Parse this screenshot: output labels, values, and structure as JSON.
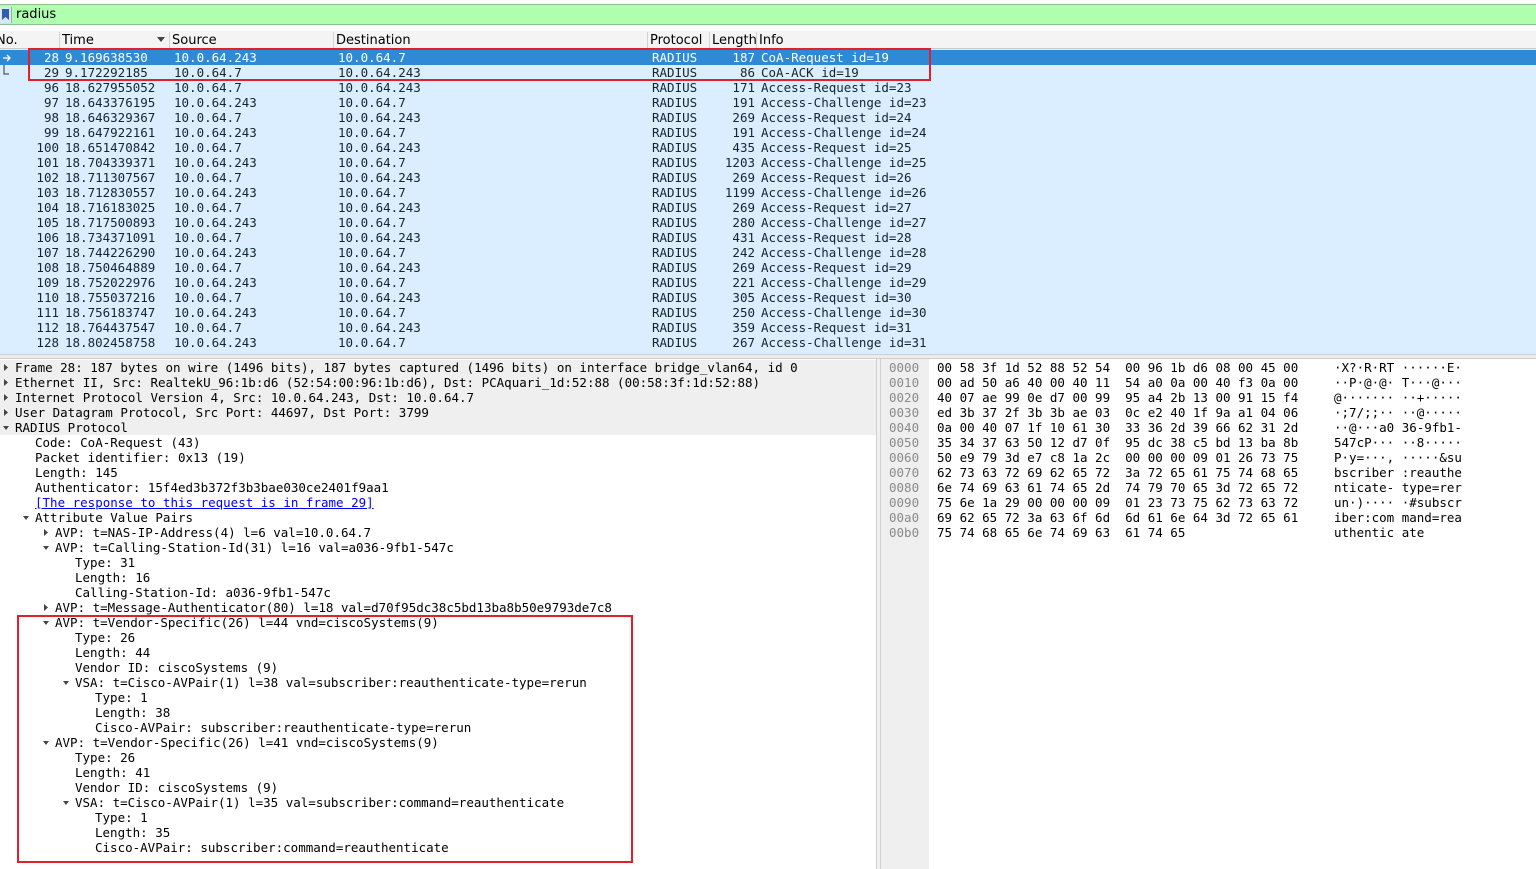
{
  "filter": {
    "value": "radius"
  },
  "columns": [
    "No.",
    "Time",
    "Source",
    "Destination",
    "Protocol",
    "Length",
    "Info"
  ],
  "packets": [
    {
      "no": "28",
      "time": "9.169638530",
      "src": "10.0.64.243",
      "dst": "10.0.64.7",
      "proto": "RADIUS",
      "len": "187",
      "info": "CoA-Request id=19"
    },
    {
      "no": "29",
      "time": "9.172292185",
      "src": "10.0.64.7",
      "dst": "10.0.64.243",
      "proto": "RADIUS",
      "len": "86",
      "info": "CoA-ACK id=19"
    },
    {
      "no": "96",
      "time": "18.627955052",
      "src": "10.0.64.7",
      "dst": "10.0.64.243",
      "proto": "RADIUS",
      "len": "171",
      "info": "Access-Request id=23"
    },
    {
      "no": "97",
      "time": "18.643376195",
      "src": "10.0.64.243",
      "dst": "10.0.64.7",
      "proto": "RADIUS",
      "len": "191",
      "info": "Access-Challenge id=23"
    },
    {
      "no": "98",
      "time": "18.646329367",
      "src": "10.0.64.7",
      "dst": "10.0.64.243",
      "proto": "RADIUS",
      "len": "269",
      "info": "Access-Request id=24"
    },
    {
      "no": "99",
      "time": "18.647922161",
      "src": "10.0.64.243",
      "dst": "10.0.64.7",
      "proto": "RADIUS",
      "len": "191",
      "info": "Access-Challenge id=24"
    },
    {
      "no": "100",
      "time": "18.651470842",
      "src": "10.0.64.7",
      "dst": "10.0.64.243",
      "proto": "RADIUS",
      "len": "435",
      "info": "Access-Request id=25"
    },
    {
      "no": "101",
      "time": "18.704339371",
      "src": "10.0.64.243",
      "dst": "10.0.64.7",
      "proto": "RADIUS",
      "len": "1203",
      "info": "Access-Challenge id=25"
    },
    {
      "no": "102",
      "time": "18.711307567",
      "src": "10.0.64.7",
      "dst": "10.0.64.243",
      "proto": "RADIUS",
      "len": "269",
      "info": "Access-Request id=26"
    },
    {
      "no": "103",
      "time": "18.712830557",
      "src": "10.0.64.243",
      "dst": "10.0.64.7",
      "proto": "RADIUS",
      "len": "1199",
      "info": "Access-Challenge id=26"
    },
    {
      "no": "104",
      "time": "18.716183025",
      "src": "10.0.64.7",
      "dst": "10.0.64.243",
      "proto": "RADIUS",
      "len": "269",
      "info": "Access-Request id=27"
    },
    {
      "no": "105",
      "time": "18.717500893",
      "src": "10.0.64.243",
      "dst": "10.0.64.7",
      "proto": "RADIUS",
      "len": "280",
      "info": "Access-Challenge id=27"
    },
    {
      "no": "106",
      "time": "18.734371091",
      "src": "10.0.64.7",
      "dst": "10.0.64.243",
      "proto": "RADIUS",
      "len": "431",
      "info": "Access-Request id=28"
    },
    {
      "no": "107",
      "time": "18.744226290",
      "src": "10.0.64.243",
      "dst": "10.0.64.7",
      "proto": "RADIUS",
      "len": "242",
      "info": "Access-Challenge id=28"
    },
    {
      "no": "108",
      "time": "18.750464889",
      "src": "10.0.64.7",
      "dst": "10.0.64.243",
      "proto": "RADIUS",
      "len": "269",
      "info": "Access-Request id=29"
    },
    {
      "no": "109",
      "time": "18.752022976",
      "src": "10.0.64.243",
      "dst": "10.0.64.7",
      "proto": "RADIUS",
      "len": "221",
      "info": "Access-Challenge id=29"
    },
    {
      "no": "110",
      "time": "18.755037216",
      "src": "10.0.64.7",
      "dst": "10.0.64.243",
      "proto": "RADIUS",
      "len": "305",
      "info": "Access-Request id=30"
    },
    {
      "no": "111",
      "time": "18.756183747",
      "src": "10.0.64.243",
      "dst": "10.0.64.7",
      "proto": "RADIUS",
      "len": "250",
      "info": "Access-Challenge id=30"
    },
    {
      "no": "112",
      "time": "18.764437547",
      "src": "10.0.64.7",
      "dst": "10.0.64.243",
      "proto": "RADIUS",
      "len": "359",
      "info": "Access-Request id=31"
    },
    {
      "no": "128",
      "time": "18.802458758",
      "src": "10.0.64.243",
      "dst": "10.0.64.7",
      "proto": "RADIUS",
      "len": "267",
      "info": "Access-Challenge id=31"
    }
  ],
  "selected_packet_index": 0,
  "details": [
    {
      "level": 0,
      "toggle": "collapsed",
      "text": "Frame 28: 187 bytes on wire (1496 bits), 187 bytes captured (1496 bits) on interface bridge_vlan64, id 0"
    },
    {
      "level": 0,
      "toggle": "collapsed",
      "text": "Ethernet II, Src: RealtekU_96:1b:d6 (52:54:00:96:1b:d6), Dst: PCAquari_1d:52:88 (00:58:3f:1d:52:88)"
    },
    {
      "level": 0,
      "toggle": "collapsed",
      "text": "Internet Protocol Version 4, Src: 10.0.64.243, Dst: 10.0.64.7"
    },
    {
      "level": 0,
      "toggle": "collapsed",
      "text": "User Datagram Protocol, Src Port: 44697, Dst Port: 3799"
    },
    {
      "level": 0,
      "toggle": "expanded",
      "text": "RADIUS Protocol"
    },
    {
      "level": 1,
      "toggle": "none",
      "text": "Code: CoA-Request (43)"
    },
    {
      "level": 1,
      "toggle": "none",
      "text": "Packet identifier: 0x13 (19)"
    },
    {
      "level": 1,
      "toggle": "none",
      "text": "Length: 145"
    },
    {
      "level": 1,
      "toggle": "none",
      "text": "Authenticator: 15f4ed3b372f3b3bae030ce2401f9aa1"
    },
    {
      "level": 1,
      "toggle": "none",
      "text": "[The response to this request is in frame 29]",
      "link": true
    },
    {
      "level": 1,
      "toggle": "expanded",
      "text": "Attribute Value Pairs"
    },
    {
      "level": 2,
      "toggle": "collapsed",
      "text": "AVP: t=NAS-IP-Address(4) l=6 val=10.0.64.7"
    },
    {
      "level": 2,
      "toggle": "expanded",
      "text": "AVP: t=Calling-Station-Id(31) l=16 val=a036-9fb1-547c"
    },
    {
      "level": 3,
      "toggle": "none",
      "text": "Type: 31"
    },
    {
      "level": 3,
      "toggle": "none",
      "text": "Length: 16"
    },
    {
      "level": 3,
      "toggle": "none",
      "text": "Calling-Station-Id: a036-9fb1-547c"
    },
    {
      "level": 2,
      "toggle": "collapsed",
      "text": "AVP: t=Message-Authenticator(80) l=18 val=d70f95dc38c5bd13ba8b50e9793de7c8"
    },
    {
      "level": 2,
      "toggle": "expanded",
      "text": "AVP: t=Vendor-Specific(26) l=44 vnd=ciscoSystems(9)"
    },
    {
      "level": 3,
      "toggle": "none",
      "text": "Type: 26"
    },
    {
      "level": 3,
      "toggle": "none",
      "text": "Length: 44"
    },
    {
      "level": 3,
      "toggle": "none",
      "text": "Vendor ID: ciscoSystems (9)"
    },
    {
      "level": 3,
      "toggle": "expanded",
      "text": "VSA: t=Cisco-AVPair(1) l=38 val=subscriber:reauthenticate-type=rerun"
    },
    {
      "level": 4,
      "toggle": "none",
      "text": "Type: 1"
    },
    {
      "level": 4,
      "toggle": "none",
      "text": "Length: 38"
    },
    {
      "level": 4,
      "toggle": "none",
      "text": "Cisco-AVPair: subscriber:reauthenticate-type=rerun"
    },
    {
      "level": 2,
      "toggle": "expanded",
      "text": "AVP: t=Vendor-Specific(26) l=41 vnd=ciscoSystems(9)"
    },
    {
      "level": 3,
      "toggle": "none",
      "text": "Type: 26"
    },
    {
      "level": 3,
      "toggle": "none",
      "text": "Length: 41"
    },
    {
      "level": 3,
      "toggle": "none",
      "text": "Vendor ID: ciscoSystems (9)"
    },
    {
      "level": 3,
      "toggle": "expanded",
      "text": "VSA: t=Cisco-AVPair(1) l=35 val=subscriber:command=reauthenticate"
    },
    {
      "level": 4,
      "toggle": "none",
      "text": "Type: 1"
    },
    {
      "level": 4,
      "toggle": "none",
      "text": "Length: 35"
    },
    {
      "level": 4,
      "toggle": "none",
      "text": "Cisco-AVPair: subscriber:command=reauthenticate"
    }
  ],
  "bytes": [
    {
      "offset": "0000",
      "hex": "00 58 3f 1d 52 88 52 54  00 96 1b d6 08 00 45 00",
      "ascii": "·X?·R·RT ······E·"
    },
    {
      "offset": "0010",
      "hex": "00 ad 50 a6 40 00 40 11  54 a0 0a 00 40 f3 0a 00",
      "ascii": "··P·@·@· T···@···"
    },
    {
      "offset": "0020",
      "hex": "40 07 ae 99 0e d7 00 99  95 a4 2b 13 00 91 15 f4",
      "ascii": "@······· ··+·····"
    },
    {
      "offset": "0030",
      "hex": "ed 3b 37 2f 3b 3b ae 03  0c e2 40 1f 9a a1 04 06",
      "ascii": "·;7/;;·· ··@·····"
    },
    {
      "offset": "0040",
      "hex": "0a 00 40 07 1f 10 61 30  33 36 2d 39 66 62 31 2d",
      "ascii": "··@···a0 36-9fb1-"
    },
    {
      "offset": "0050",
      "hex": "35 34 37 63 50 12 d7 0f  95 dc 38 c5 bd 13 ba 8b",
      "ascii": "547cP··· ··8·····"
    },
    {
      "offset": "0060",
      "hex": "50 e9 79 3d e7 c8 1a 2c  00 00 00 09 01 26 73 75",
      "ascii": "P·y=···, ·····&su"
    },
    {
      "offset": "0070",
      "hex": "62 73 63 72 69 62 65 72  3a 72 65 61 75 74 68 65",
      "ascii": "bscriber :reauthe"
    },
    {
      "offset": "0080",
      "hex": "6e 74 69 63 61 74 65 2d  74 79 70 65 3d 72 65 72",
      "ascii": "nticate- type=rer"
    },
    {
      "offset": "0090",
      "hex": "75 6e 1a 29 00 00 00 09  01 23 73 75 62 73 63 72",
      "ascii": "un·)···· ·#subscr"
    },
    {
      "offset": "00a0",
      "hex": "69 62 65 72 3a 63 6f 6d  6d 61 6e 64 3d 72 65 61",
      "ascii": "iber:com mand=rea"
    },
    {
      "offset": "00b0",
      "hex": "75 74 68 65 6e 74 69 63  61 74 65",
      "ascii": "uthentic ate"
    }
  ],
  "colors": {
    "filter_ok": "#afffaf",
    "row_bg": "#dbeeff",
    "row_selected": "#2f8ad6",
    "annotation": "#e0202a"
  }
}
